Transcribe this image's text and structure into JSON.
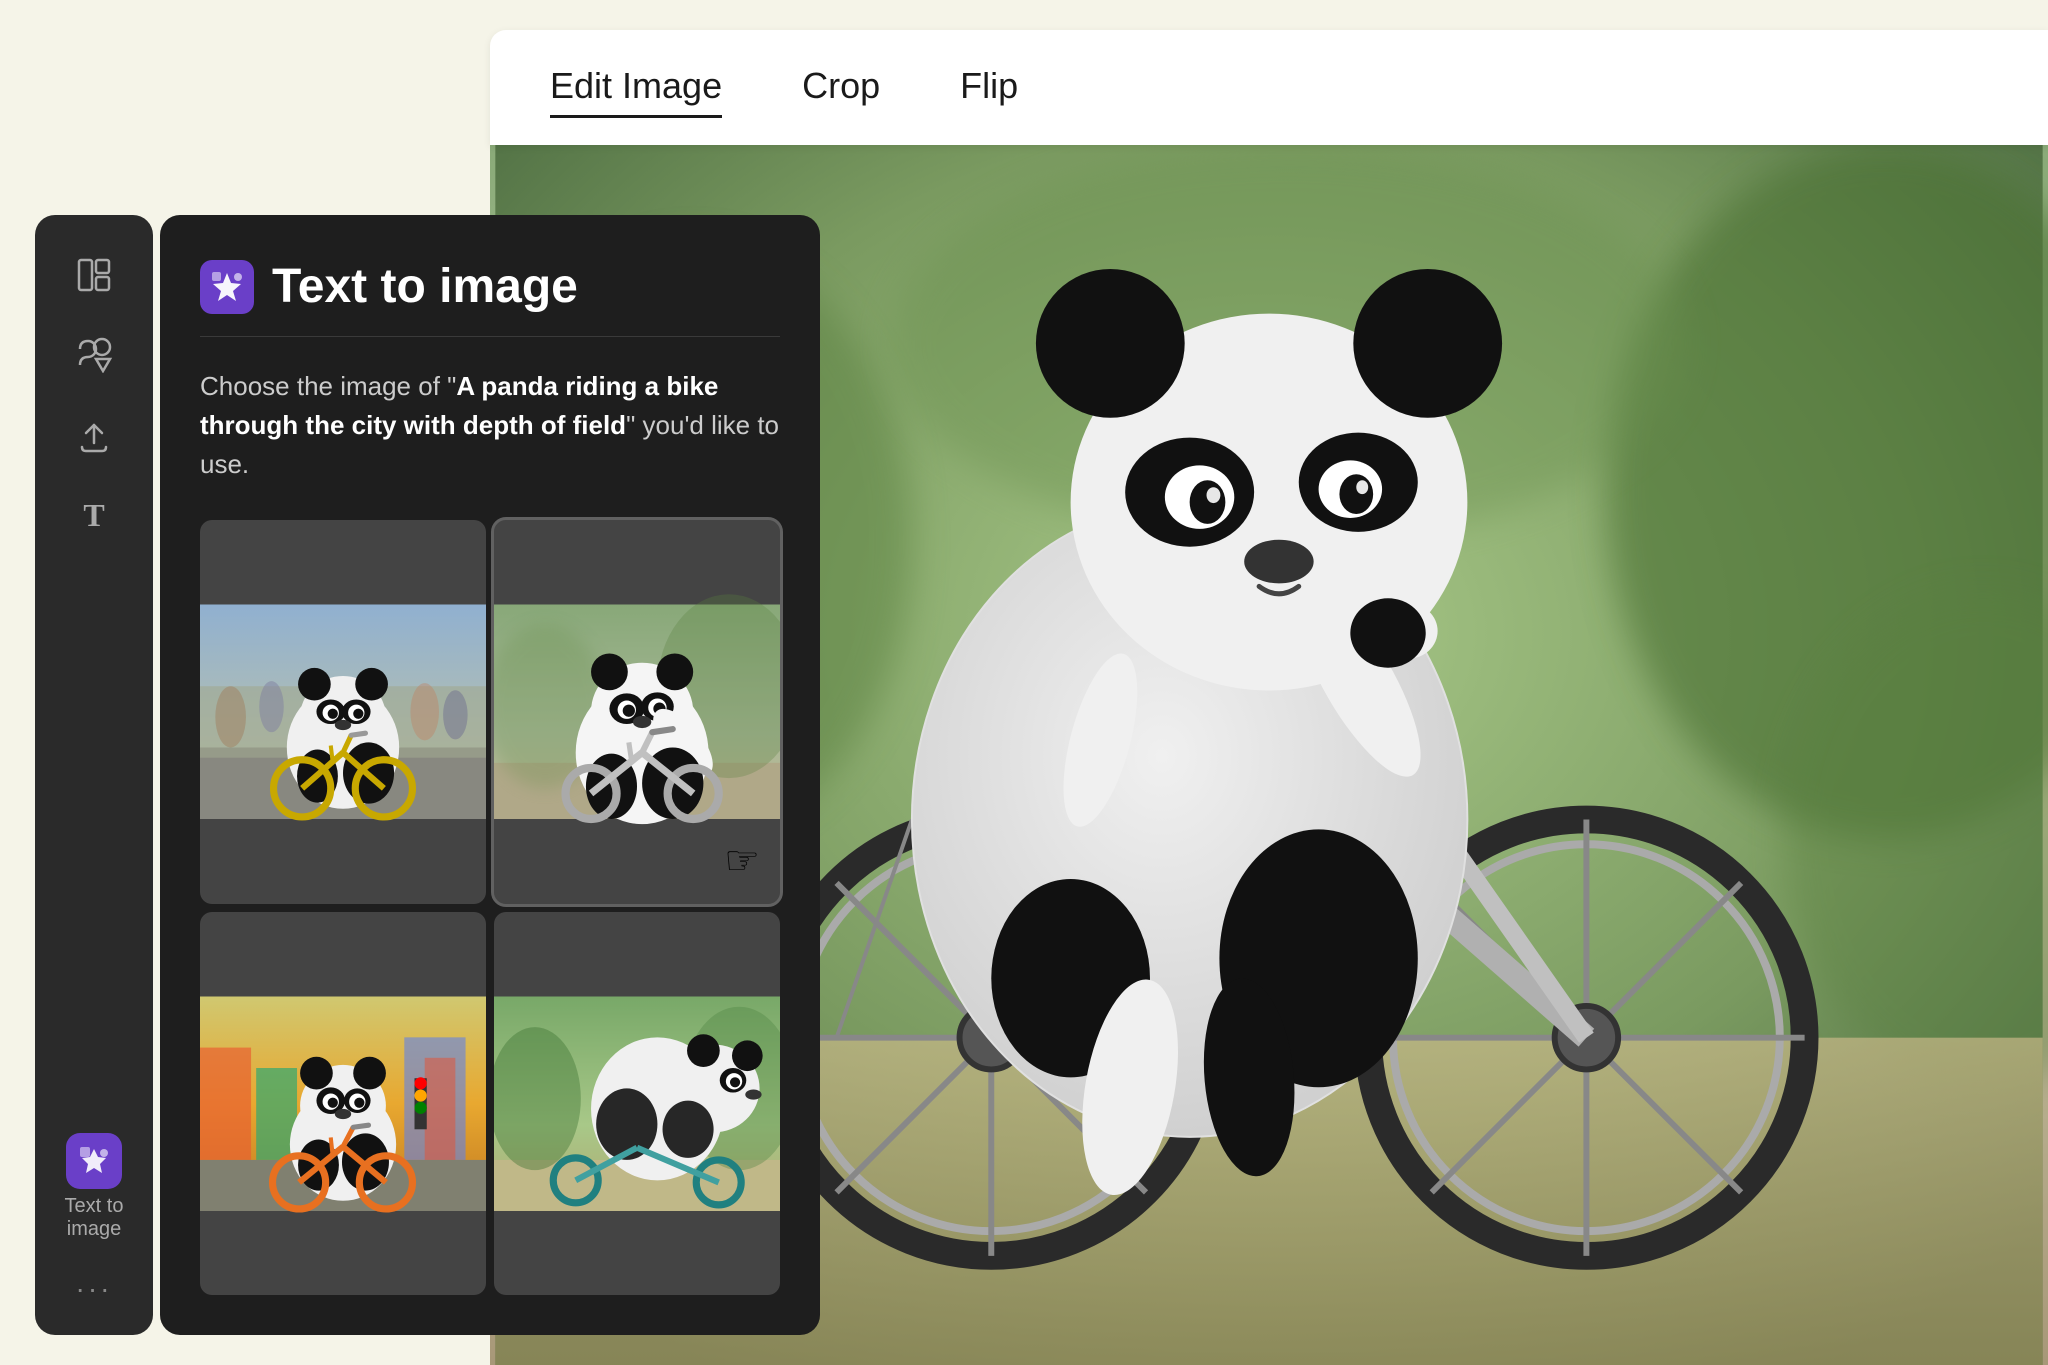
{
  "app": {
    "background_color": "#f5f4e8"
  },
  "edit_panel": {
    "tabs": [
      {
        "id": "edit-image",
        "label": "Edit Image",
        "active": true
      },
      {
        "id": "crop",
        "label": "Crop",
        "active": false
      },
      {
        "id": "flip",
        "label": "Flip",
        "active": false
      }
    ]
  },
  "sidebar": {
    "icons": [
      {
        "id": "layout-icon",
        "symbol": "⊞",
        "label": "",
        "active": false
      },
      {
        "id": "shapes-icon",
        "symbol": "◇△",
        "label": "",
        "active": false
      },
      {
        "id": "upload-icon",
        "symbol": "↑",
        "label": "",
        "active": false
      },
      {
        "id": "text-icon",
        "symbol": "T",
        "label": "",
        "active": false
      }
    ],
    "active_item": {
      "id": "text-to-image-sidebar",
      "icon": "✦",
      "label": "Text to image"
    },
    "more_icon": "···"
  },
  "tti_panel": {
    "title": "Text to image",
    "icon": "✦",
    "description_prefix": "Choose the image of ",
    "description_quote": "A panda riding a bike through the city with depth of field",
    "description_suffix": " you'd like to use.",
    "grid": [
      {
        "id": "panda-1",
        "alt": "Panda on yellow bike in city street"
      },
      {
        "id": "panda-2",
        "alt": "Panda on silver scooter, blurred background"
      },
      {
        "id": "panda-3",
        "alt": "Panda on orange bike in colorful city"
      },
      {
        "id": "panda-4",
        "alt": "Panda side view on bike in park"
      }
    ]
  },
  "main_image": {
    "alt": "Large panda riding a bicycle, 3D rendered, depth of field",
    "selected_grid_index": 1
  }
}
